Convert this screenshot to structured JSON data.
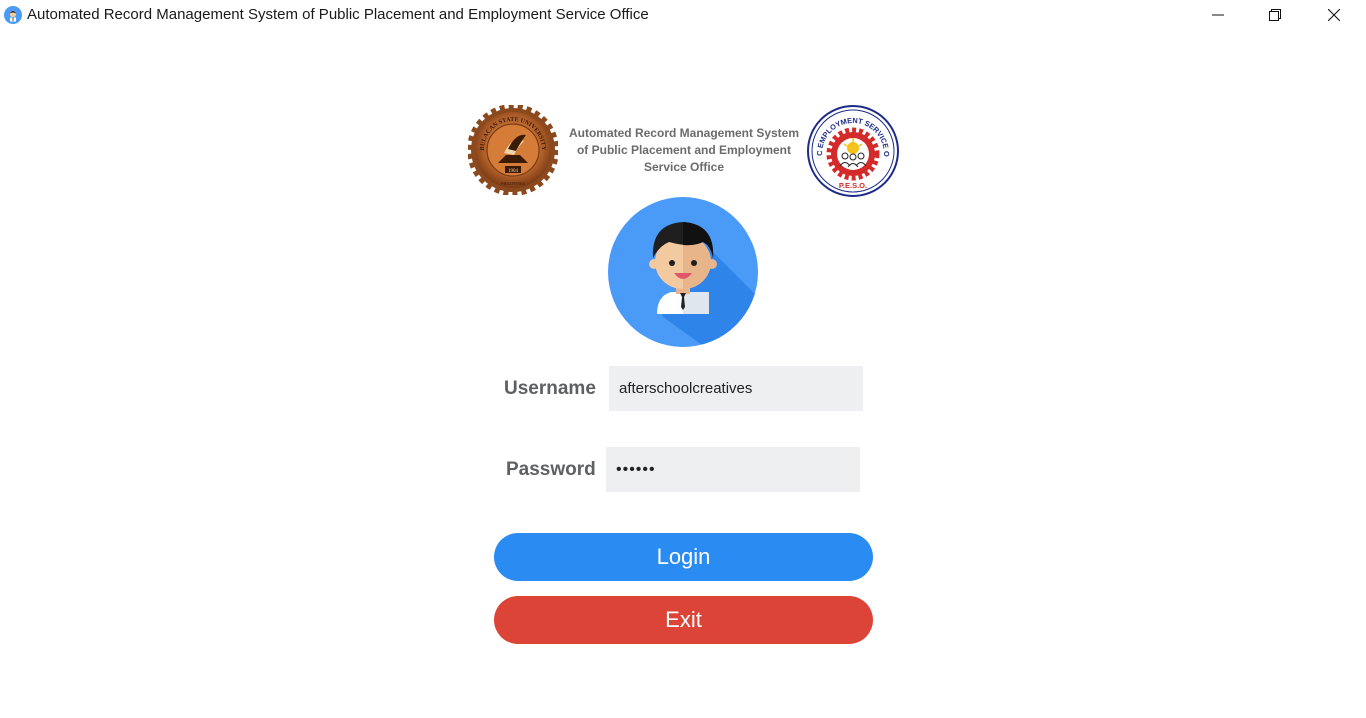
{
  "window": {
    "title": "Automated Record Management System of Public Placement and Employment Service Office",
    "controls": [
      "minimize",
      "maximize",
      "close"
    ]
  },
  "header": {
    "title_lines": [
      "Automated Record Management System",
      "of Public Placement and Employment",
      "Service Office"
    ],
    "left_logo": {
      "name": "bulacan-state-university-seal",
      "text": "BULACAN STATE UNIVERSITY",
      "year": "1904",
      "bottom_text": "PHILIPPINES"
    },
    "right_logo": {
      "name": "peso-seal",
      "text": "PUBLIC EMPLOYMENT SERVICE OFFICE",
      "bottom_text": "P.E.S.O."
    }
  },
  "avatar": {
    "icon": "user-avatar-icon",
    "colors": {
      "background": "#4a9af7",
      "shadow": "#2f84ea"
    }
  },
  "form": {
    "username_label": "Username",
    "username_value": "afterschoolcreatives",
    "password_label": "Password",
    "password_value": "••••••"
  },
  "buttons": {
    "login_label": "Login",
    "exit_label": "Exit"
  },
  "colors": {
    "login": "#2a8bf2",
    "exit": "#dc4438",
    "input_bg": "#edeff0",
    "label": "#5f6062"
  }
}
